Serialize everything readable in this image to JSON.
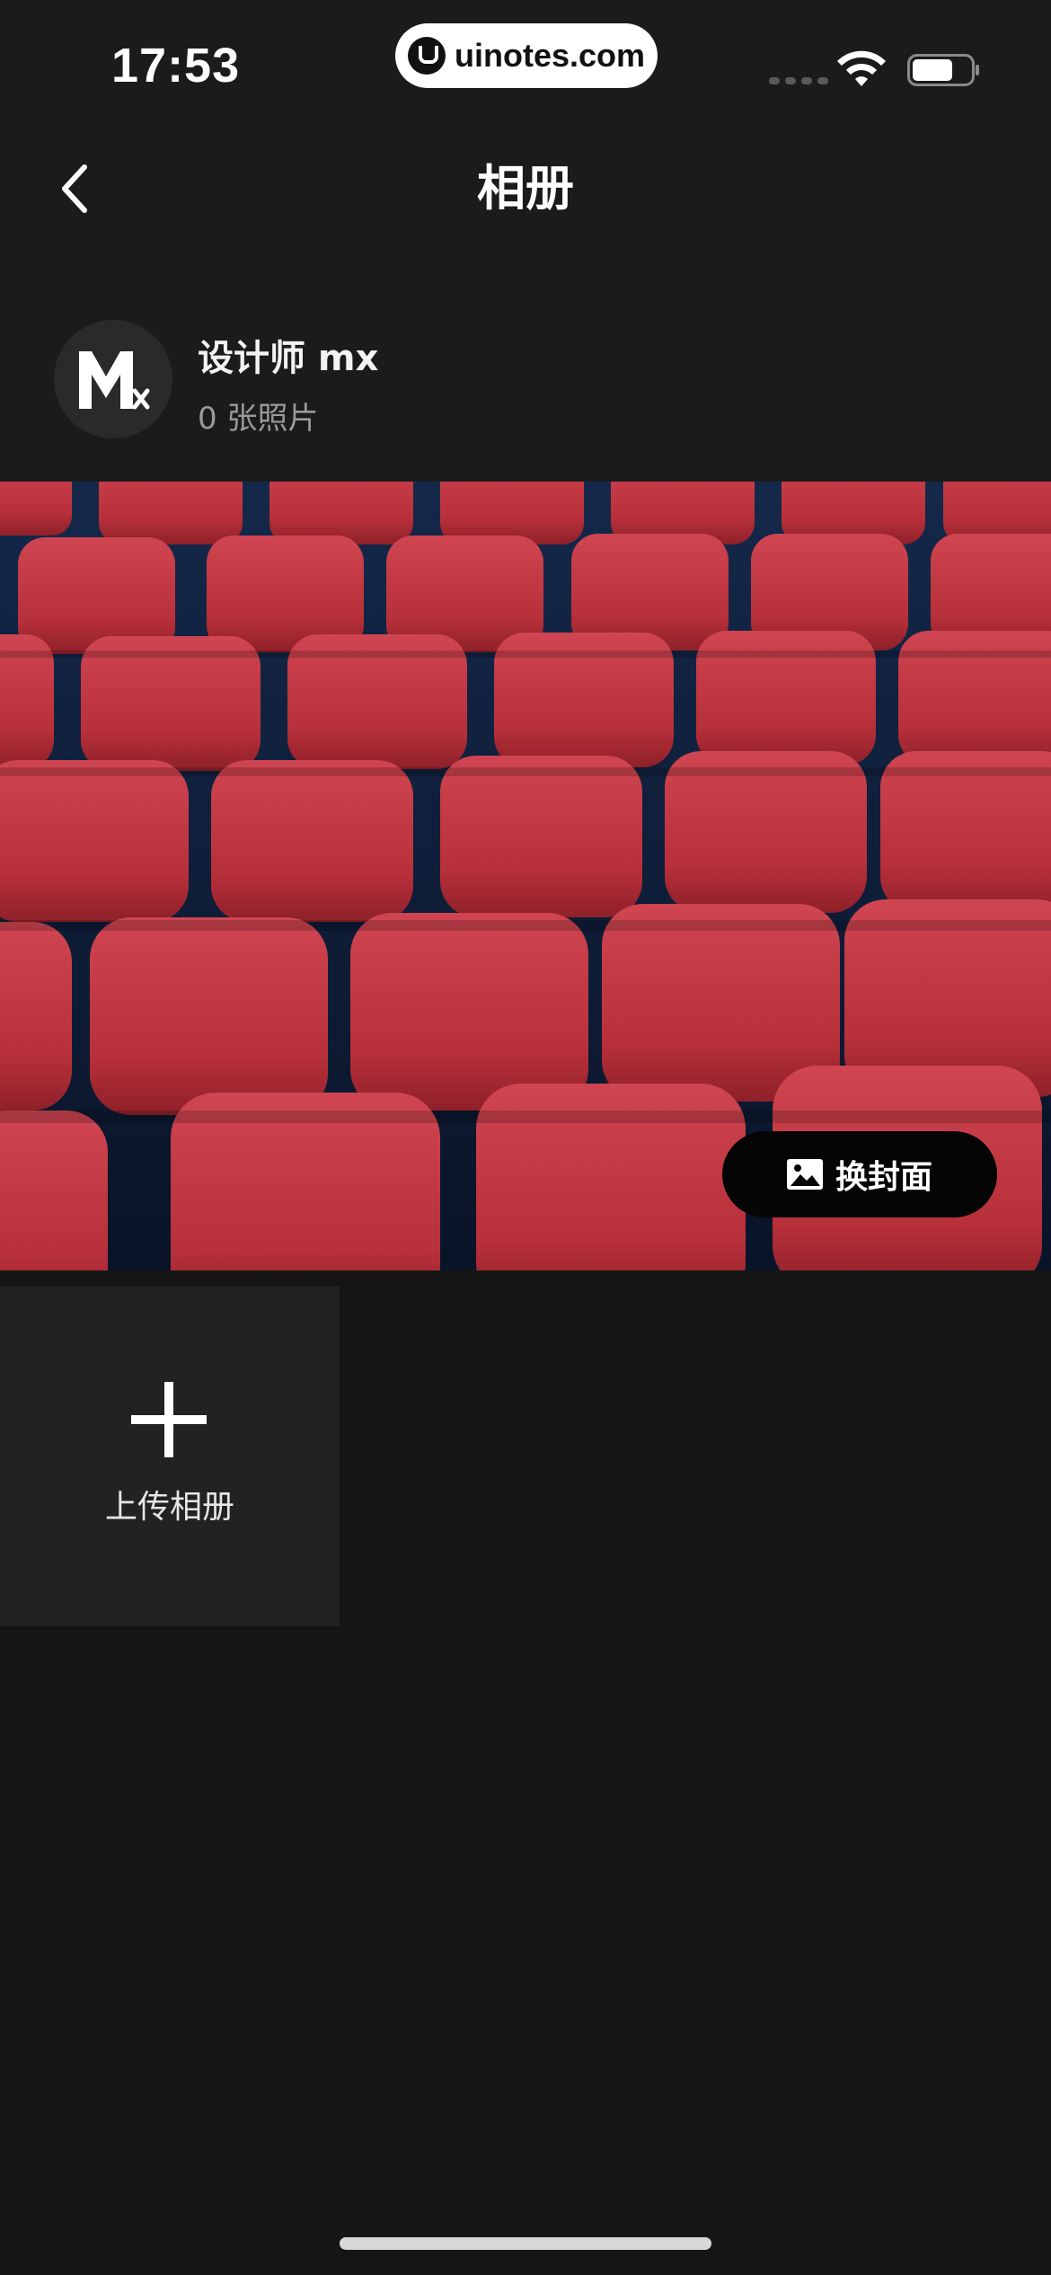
{
  "status_bar": {
    "time": "17:53",
    "url": "uinotes.com"
  },
  "nav": {
    "title": "相册"
  },
  "profile": {
    "name": "设计师 mx",
    "photo_count": "0 张照片"
  },
  "cover": {
    "button_label": "换封面"
  },
  "upload": {
    "label": "上传相册"
  },
  "icons": {
    "back": "chevron-left-icon",
    "wifi": "wifi-icon",
    "battery": "battery-icon",
    "image": "image-icon",
    "plus": "plus-icon"
  },
  "colors": {
    "background": "#151515",
    "header_bg": "#1b1b1b",
    "tile_bg": "#222222",
    "seat_red": "#c1353f",
    "seat_floor": "#0e1e3a"
  }
}
